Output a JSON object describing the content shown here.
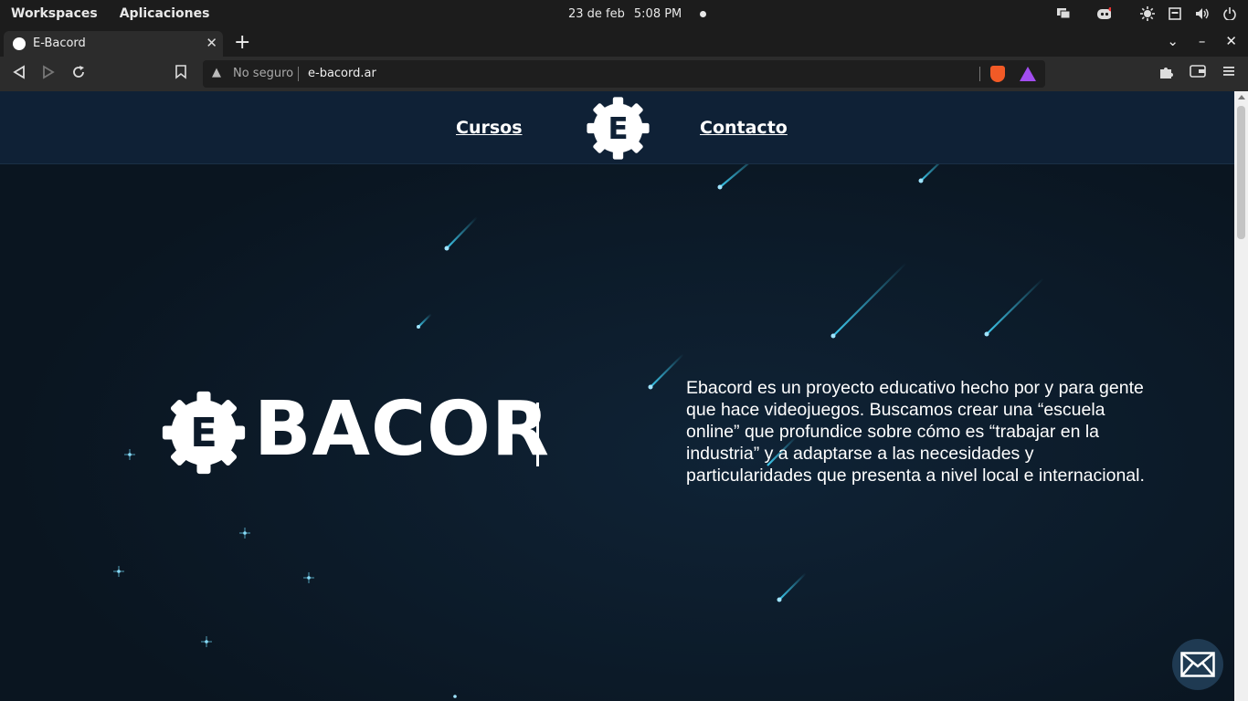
{
  "os_bar": {
    "workspaces": "Workspaces",
    "apps": "Aplicaciones",
    "date": "23 de feb",
    "time": "5:08 PM"
  },
  "browser": {
    "tab_title": "E-Bacord",
    "new_tab": "+",
    "close_tab": "✕",
    "security": "No seguro",
    "url": "e-bacord.ar"
  },
  "site": {
    "nav_courses": "Cursos",
    "nav_contact": "Contacto",
    "brand_text": "BACOR",
    "description": "Ebacord es un proyecto educativo hecho por y para gente que hace videojuegos. Buscamos crear una “escuela online” que profundice sobre cómo es “trabajar en la industria” y a adaptarse a las necesidades y particularidades que presenta a nivel local e internacional.",
    "logo_letter": "E"
  },
  "colors": {
    "accent_star": "#3fd0f5",
    "header_bg": "#0f2136",
    "page_bg": "#0a1520"
  }
}
